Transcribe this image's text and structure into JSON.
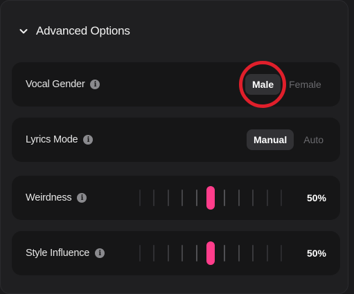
{
  "section": {
    "title": "Advanced Options",
    "expanded": true,
    "icon": "chevron-down-icon"
  },
  "vocal_gender": {
    "label": "Vocal Gender",
    "info_icon": "info-icon",
    "options": [
      "Male",
      "Female"
    ],
    "selected": "Male",
    "highlight_color": "#e01f2b"
  },
  "lyrics_mode": {
    "label": "Lyrics Mode",
    "info_icon": "info-icon",
    "options": [
      "Manual",
      "Auto"
    ],
    "selected": "Manual"
  },
  "weirdness": {
    "label": "Weirdness",
    "info_icon": "info-icon",
    "value": 50,
    "value_text": "50%",
    "accent_color": "#ff3d8b"
  },
  "style_influence": {
    "label": "Style Influence",
    "info_icon": "info-icon",
    "value": 50,
    "value_text": "50%",
    "accent_color": "#ff3d8b"
  }
}
